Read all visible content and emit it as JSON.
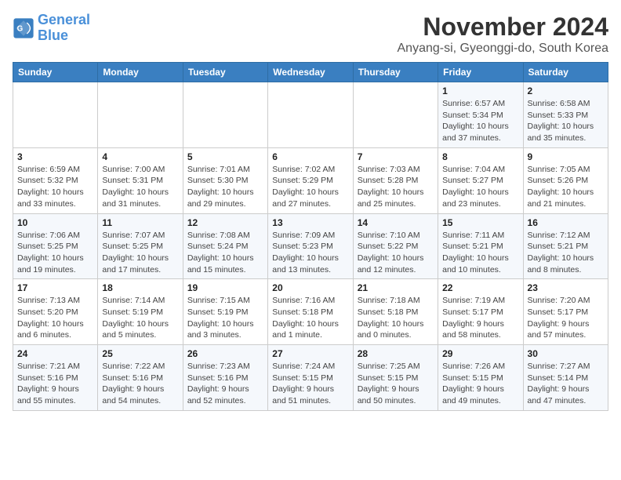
{
  "logo": {
    "line1": "General",
    "line2": "Blue"
  },
  "title": "November 2024",
  "subtitle": "Anyang-si, Gyeonggi-do, South Korea",
  "weekdays": [
    "Sunday",
    "Monday",
    "Tuesday",
    "Wednesday",
    "Thursday",
    "Friday",
    "Saturday"
  ],
  "weeks": [
    [
      {
        "day": "",
        "info": ""
      },
      {
        "day": "",
        "info": ""
      },
      {
        "day": "",
        "info": ""
      },
      {
        "day": "",
        "info": ""
      },
      {
        "day": "",
        "info": ""
      },
      {
        "day": "1",
        "info": "Sunrise: 6:57 AM\nSunset: 5:34 PM\nDaylight: 10 hours and 37 minutes."
      },
      {
        "day": "2",
        "info": "Sunrise: 6:58 AM\nSunset: 5:33 PM\nDaylight: 10 hours and 35 minutes."
      }
    ],
    [
      {
        "day": "3",
        "info": "Sunrise: 6:59 AM\nSunset: 5:32 PM\nDaylight: 10 hours and 33 minutes."
      },
      {
        "day": "4",
        "info": "Sunrise: 7:00 AM\nSunset: 5:31 PM\nDaylight: 10 hours and 31 minutes."
      },
      {
        "day": "5",
        "info": "Sunrise: 7:01 AM\nSunset: 5:30 PM\nDaylight: 10 hours and 29 minutes."
      },
      {
        "day": "6",
        "info": "Sunrise: 7:02 AM\nSunset: 5:29 PM\nDaylight: 10 hours and 27 minutes."
      },
      {
        "day": "7",
        "info": "Sunrise: 7:03 AM\nSunset: 5:28 PM\nDaylight: 10 hours and 25 minutes."
      },
      {
        "day": "8",
        "info": "Sunrise: 7:04 AM\nSunset: 5:27 PM\nDaylight: 10 hours and 23 minutes."
      },
      {
        "day": "9",
        "info": "Sunrise: 7:05 AM\nSunset: 5:26 PM\nDaylight: 10 hours and 21 minutes."
      }
    ],
    [
      {
        "day": "10",
        "info": "Sunrise: 7:06 AM\nSunset: 5:25 PM\nDaylight: 10 hours and 19 minutes."
      },
      {
        "day": "11",
        "info": "Sunrise: 7:07 AM\nSunset: 5:25 PM\nDaylight: 10 hours and 17 minutes."
      },
      {
        "day": "12",
        "info": "Sunrise: 7:08 AM\nSunset: 5:24 PM\nDaylight: 10 hours and 15 minutes."
      },
      {
        "day": "13",
        "info": "Sunrise: 7:09 AM\nSunset: 5:23 PM\nDaylight: 10 hours and 13 minutes."
      },
      {
        "day": "14",
        "info": "Sunrise: 7:10 AM\nSunset: 5:22 PM\nDaylight: 10 hours and 12 minutes."
      },
      {
        "day": "15",
        "info": "Sunrise: 7:11 AM\nSunset: 5:21 PM\nDaylight: 10 hours and 10 minutes."
      },
      {
        "day": "16",
        "info": "Sunrise: 7:12 AM\nSunset: 5:21 PM\nDaylight: 10 hours and 8 minutes."
      }
    ],
    [
      {
        "day": "17",
        "info": "Sunrise: 7:13 AM\nSunset: 5:20 PM\nDaylight: 10 hours and 6 minutes."
      },
      {
        "day": "18",
        "info": "Sunrise: 7:14 AM\nSunset: 5:19 PM\nDaylight: 10 hours and 5 minutes."
      },
      {
        "day": "19",
        "info": "Sunrise: 7:15 AM\nSunset: 5:19 PM\nDaylight: 10 hours and 3 minutes."
      },
      {
        "day": "20",
        "info": "Sunrise: 7:16 AM\nSunset: 5:18 PM\nDaylight: 10 hours and 1 minute."
      },
      {
        "day": "21",
        "info": "Sunrise: 7:18 AM\nSunset: 5:18 PM\nDaylight: 10 hours and 0 minutes."
      },
      {
        "day": "22",
        "info": "Sunrise: 7:19 AM\nSunset: 5:17 PM\nDaylight: 9 hours and 58 minutes."
      },
      {
        "day": "23",
        "info": "Sunrise: 7:20 AM\nSunset: 5:17 PM\nDaylight: 9 hours and 57 minutes."
      }
    ],
    [
      {
        "day": "24",
        "info": "Sunrise: 7:21 AM\nSunset: 5:16 PM\nDaylight: 9 hours and 55 minutes."
      },
      {
        "day": "25",
        "info": "Sunrise: 7:22 AM\nSunset: 5:16 PM\nDaylight: 9 hours and 54 minutes."
      },
      {
        "day": "26",
        "info": "Sunrise: 7:23 AM\nSunset: 5:16 PM\nDaylight: 9 hours and 52 minutes."
      },
      {
        "day": "27",
        "info": "Sunrise: 7:24 AM\nSunset: 5:15 PM\nDaylight: 9 hours and 51 minutes."
      },
      {
        "day": "28",
        "info": "Sunrise: 7:25 AM\nSunset: 5:15 PM\nDaylight: 9 hours and 50 minutes."
      },
      {
        "day": "29",
        "info": "Sunrise: 7:26 AM\nSunset: 5:15 PM\nDaylight: 9 hours and 49 minutes."
      },
      {
        "day": "30",
        "info": "Sunrise: 7:27 AM\nSunset: 5:14 PM\nDaylight: 9 hours and 47 minutes."
      }
    ]
  ]
}
